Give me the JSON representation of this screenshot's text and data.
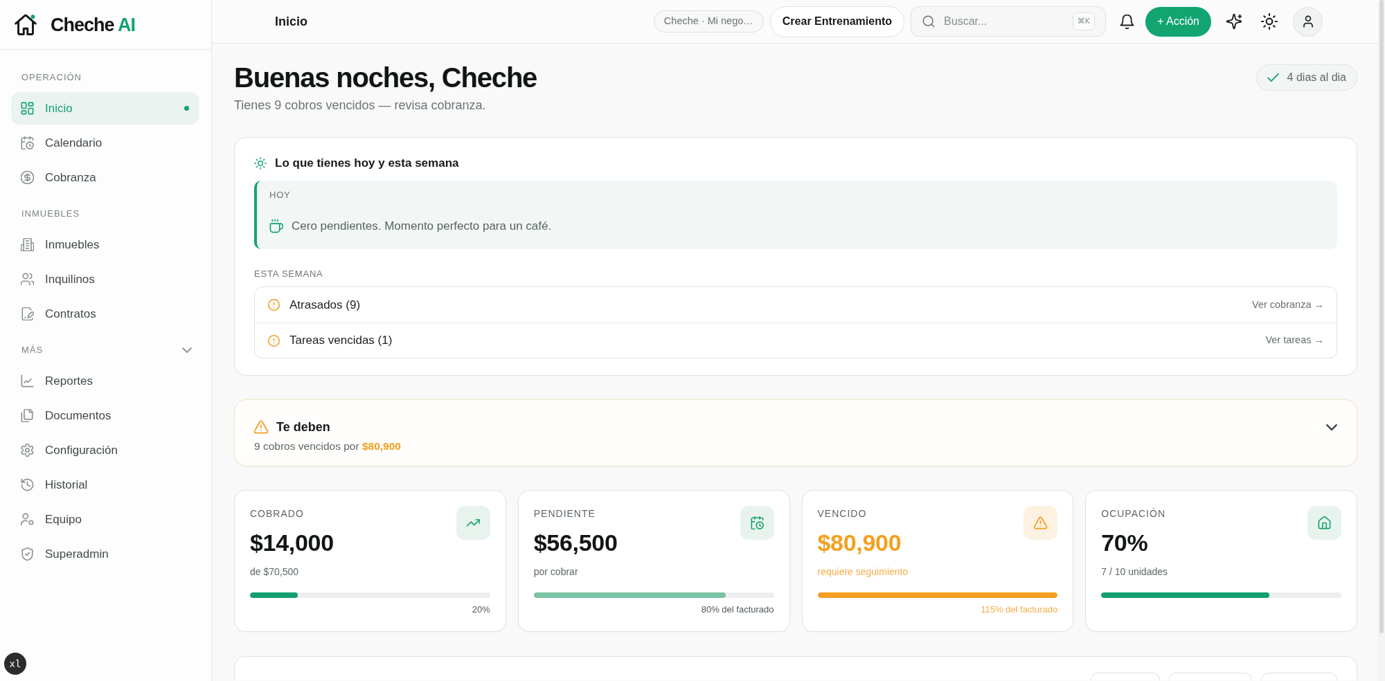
{
  "sidebar": {
    "brand": {
      "name": "Cheche",
      "accent": "AI"
    },
    "sections": [
      {
        "title": "OPERACIÓN",
        "collapsible": false,
        "items": [
          {
            "label": "Inicio",
            "selected": true
          },
          {
            "label": "Calendario",
            "selected": false
          },
          {
            "label": "Cobranza",
            "selected": false
          }
        ]
      },
      {
        "title": "INMUEBLES",
        "collapsible": false,
        "items": [
          {
            "label": "Inmuebles",
            "selected": false
          },
          {
            "label": "Inquilinos",
            "selected": false
          },
          {
            "label": "Contratos",
            "selected": false
          }
        ]
      },
      {
        "title": "MÁS",
        "collapsible": true,
        "items": [
          {
            "label": "Reportes",
            "selected": false
          },
          {
            "label": "Documentos",
            "selected": false
          },
          {
            "label": "Configuración",
            "selected": false
          },
          {
            "label": "Historial",
            "selected": false
          },
          {
            "label": "Equipo",
            "selected": false
          },
          {
            "label": "Superadmin",
            "selected": false
          }
        ]
      }
    ]
  },
  "breakpoint_badge": "xl",
  "header": {
    "title": "Inicio",
    "workspace": "Cheche · Mi nego…",
    "train_button": "Crear Entrenamiento",
    "search": {
      "placeholder": "Buscar...",
      "shortcut": "⌘K"
    },
    "action_button": "+ Acción"
  },
  "greeting": {
    "title": "Buenas noches, Cheche",
    "subtitle": "Tienes 9 cobros vencidos — revisa cobranza.",
    "streak_badge": "4 dias al dia"
  },
  "agenda": {
    "title": "Lo que tienes hoy y esta semana",
    "today": {
      "label": "HOY",
      "message": "Cero pendientes. Momento perfecto para un café."
    },
    "week": {
      "label": "ESTA SEMANA",
      "items": [
        {
          "label": "Atrasados (9)",
          "link": "Ver cobranza →"
        },
        {
          "label": "Tareas vencidas (1)",
          "link": "Ver tareas →"
        }
      ]
    }
  },
  "debts": {
    "title": "Te deben",
    "summary": "9 cobros vencidos por **$80,900**",
    "expanded": false
  },
  "stats": [
    {
      "kind": "collected",
      "label": "COBRADO",
      "value": "$14,000",
      "caption": "de $70,500",
      "level": 0.2,
      "footnote": "20%"
    },
    {
      "kind": "pending",
      "label": "PENDIENTE",
      "value": "$56,500",
      "caption": "por cobrar",
      "level": 0.8,
      "footnote": "80% del facturado"
    },
    {
      "kind": "overdue",
      "label": "VENCIDO",
      "value": "$80,900",
      "caption": "requiere seguimiento",
      "level": 1,
      "footnote": "115% del facturado"
    },
    {
      "kind": "occupancy",
      "label": "OCUPACIÓN",
      "value": "70%",
      "caption": "7 / 10 unidades",
      "level": 0.7
    }
  ]
}
